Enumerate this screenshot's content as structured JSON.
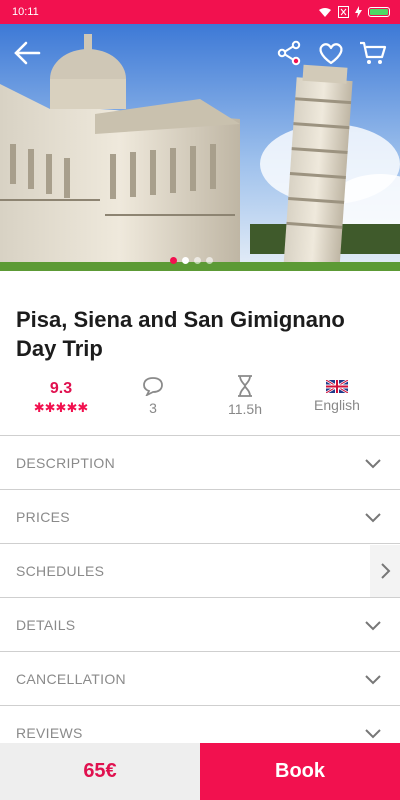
{
  "status_bar": {
    "time": "10:11",
    "bg": "#f2114f"
  },
  "hero": {
    "image_name": "pisa-cathedral-and-leaning-tower",
    "dots_count": 4,
    "active_dot": 0
  },
  "tour": {
    "title": "Pisa, Siena and San Gimignano Day Trip"
  },
  "stats": {
    "rating": "9.3",
    "stars": 5,
    "comments": "3",
    "duration": "11.5h",
    "language": "English"
  },
  "sections": [
    {
      "label": "DESCRIPTION",
      "icon": "chevron-down-icon"
    },
    {
      "label": "PRICES",
      "icon": "chevron-down-icon"
    },
    {
      "label": "SCHEDULES",
      "icon": "chevron-right-icon"
    },
    {
      "label": "DETAILS",
      "icon": "chevron-down-icon"
    },
    {
      "label": "CANCELLATION",
      "icon": "chevron-down-icon"
    },
    {
      "label": "REVIEWS",
      "icon": "chevron-down-icon"
    }
  ],
  "footer": {
    "price": "65€",
    "book_label": "Book"
  },
  "colors": {
    "accent": "#f2114f",
    "text": "#1c1c1c",
    "muted": "#8a8a8a"
  }
}
